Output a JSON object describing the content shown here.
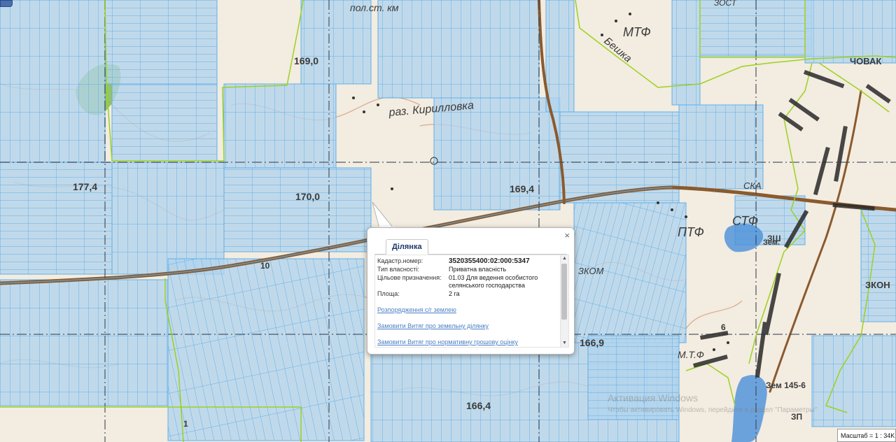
{
  "map": {
    "labels": [
      "169,0",
      "177,4",
      "170,0",
      "169,4",
      "166,9",
      "166,4",
      "МТФ",
      "ПТФ",
      "СТФ",
      "Бешка",
      "раз. Кирилловка",
      "пол.ст. км",
      "ЧОВАК",
      "СКА",
      "ЗШ",
      "ЗКОН",
      "Зем.",
      "Зем 145-6",
      "М.Т.Ф",
      "ЗКОМ",
      "ЗОСТ",
      "ЗП",
      "10",
      "6",
      "1"
    ],
    "colors": {
      "background": "#f3ece0",
      "parcel_fill": "#a9cdea",
      "parcel_line": "#5fb0ea",
      "boundary_green": "#9bd21e",
      "road": "#8a5a2e",
      "grid": "#3a4658",
      "water": "#4a90d9",
      "forest": "#8bbf5a",
      "village": "#2a2a2a"
    }
  },
  "popup": {
    "tab_label": "Ділянка",
    "close_label": "×",
    "fields": [
      {
        "label": "Кадастр.номер:",
        "value": "3520355400:02:000:5347"
      },
      {
        "label": "Тип власності:",
        "value": "Приватна власність"
      },
      {
        "label": "Цільове призначення:",
        "value": "01.03 Для ведення особистого селянського господарства"
      },
      {
        "label": "Площа:",
        "value": "2 га"
      }
    ],
    "links": [
      "Розпорядження с/г землею",
      "Замовити Витяг про земельну ділянку",
      "Замовити Витяг про нормативну грошову оцінку"
    ]
  },
  "watermark": {
    "title": "Активация Windows",
    "subtitle": "Чтобы активировать Windows, перейдите в раздел \"Параметры\""
  },
  "scale": {
    "label": "Масштаб = 1 : 34K"
  }
}
